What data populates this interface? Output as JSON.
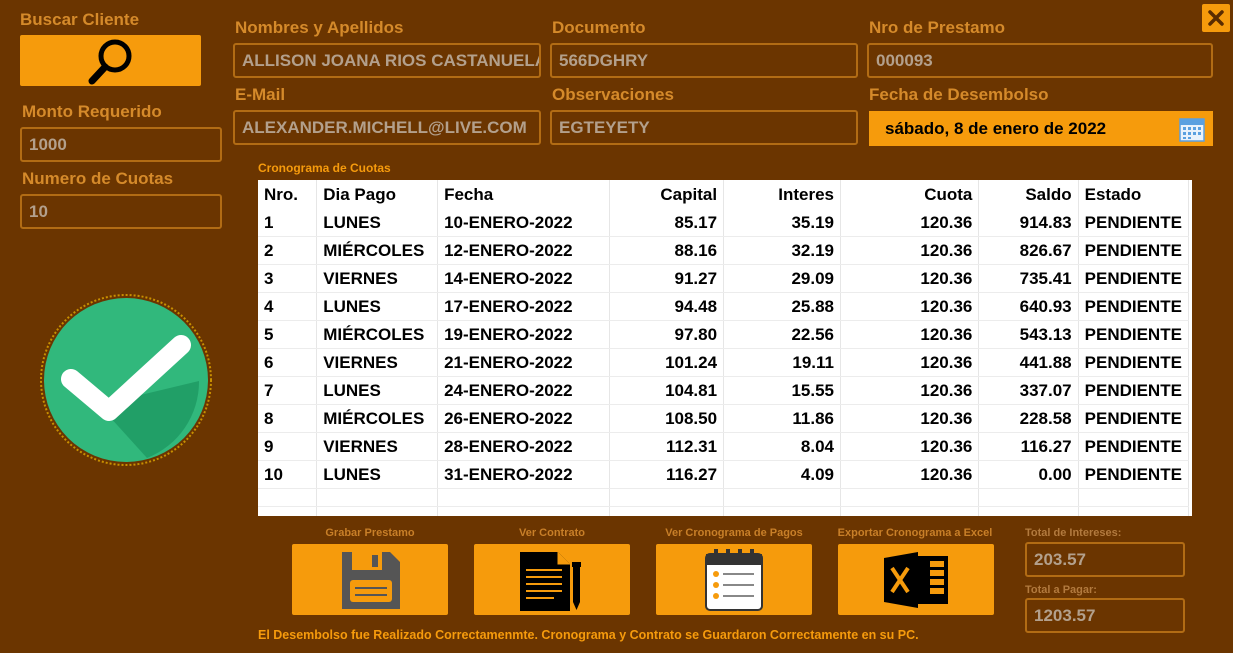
{
  "labels": {
    "buscar_cliente": "Buscar Cliente",
    "monto_requerido": "Monto Requerido",
    "numero_cuotas": "Numero de Cuotas",
    "nombres": "Nombres y Apellidos",
    "documento": "Documento",
    "nro_prestamo": "Nro de Prestamo",
    "email": "E-Mail",
    "observaciones": "Observaciones",
    "fecha_desembolso": "Fecha de Desembolso",
    "cronograma": "Cronograma de Cuotas",
    "total_intereses": "Total de Intereses:",
    "total_pagar": "Total a Pagar:"
  },
  "fields": {
    "monto": "1000",
    "cuotas": "10",
    "nombres": "ALLISON JOANA RIOS CASTANUELAS",
    "documento": "566DGHRY",
    "nro_prestamo": "000093",
    "email": "ALEXANDER.MICHELL@LIVE.COM",
    "observaciones": "EGTEYETY",
    "fecha": "sábado, 8 de enero de 2022",
    "total_intereses": "203.57",
    "total_pagar": "1203.57"
  },
  "table": {
    "headers": [
      "Nro.",
      "Dia Pago",
      "Fecha",
      "Capital",
      "Interes",
      "Cuota",
      "Saldo",
      "Estado"
    ],
    "rows": [
      [
        "1",
        "LUNES",
        "10-ENERO-2022",
        "85.17",
        "35.19",
        "120.36",
        "914.83",
        "PENDIENTE"
      ],
      [
        "2",
        "MIÉRCOLES",
        "12-ENERO-2022",
        "88.16",
        "32.19",
        "120.36",
        "826.67",
        "PENDIENTE"
      ],
      [
        "3",
        "VIERNES",
        "14-ENERO-2022",
        "91.27",
        "29.09",
        "120.36",
        "735.41",
        "PENDIENTE"
      ],
      [
        "4",
        "LUNES",
        "17-ENERO-2022",
        "94.48",
        "25.88",
        "120.36",
        "640.93",
        "PENDIENTE"
      ],
      [
        "5",
        "MIÉRCOLES",
        "19-ENERO-2022",
        "97.80",
        "22.56",
        "120.36",
        "543.13",
        "PENDIENTE"
      ],
      [
        "6",
        "VIERNES",
        "21-ENERO-2022",
        "101.24",
        "19.11",
        "120.36",
        "441.88",
        "PENDIENTE"
      ],
      [
        "7",
        "LUNES",
        "24-ENERO-2022",
        "104.81",
        "15.55",
        "120.36",
        "337.07",
        "PENDIENTE"
      ],
      [
        "8",
        "MIÉRCOLES",
        "26-ENERO-2022",
        "108.50",
        "11.86",
        "120.36",
        "228.58",
        "PENDIENTE"
      ],
      [
        "9",
        "VIERNES",
        "28-ENERO-2022",
        "112.31",
        "8.04",
        "120.36",
        "116.27",
        "PENDIENTE"
      ],
      [
        "10",
        "LUNES",
        "31-ENERO-2022",
        "116.27",
        "4.09",
        "120.36",
        "0.00",
        "PENDIENTE"
      ]
    ]
  },
  "actions": {
    "grabar": "Grabar Prestamo",
    "contrato": "Ver Contrato",
    "cronograma": "Ver Cronograma de Pagos",
    "exportar": "Exportar Cronograma a Excel"
  },
  "status_message": "El Desembolso fue Realizado Correctamenmte. Cronograma y Contrato se Guardaron Correctamente en su PC.",
  "colors": {
    "background": "#6b3500",
    "accent": "#f69b0c",
    "success": "#31b87c"
  },
  "icons": [
    "search-icon",
    "close-icon",
    "calendar-icon",
    "check-icon",
    "save-icon",
    "document-icon",
    "schedule-icon",
    "excel-icon"
  ]
}
